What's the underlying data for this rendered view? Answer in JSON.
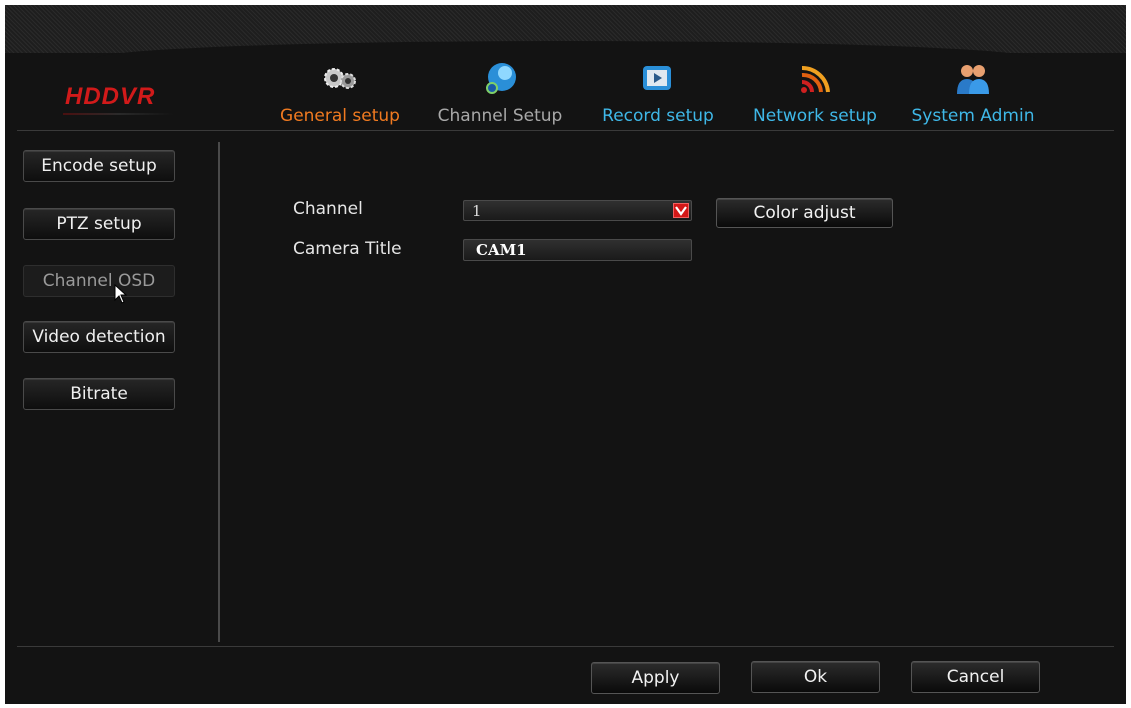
{
  "app": {
    "logo": "HDDVR"
  },
  "tabs": [
    {
      "label": "General setup",
      "icon": "gears-icon",
      "color": "#f07a20"
    },
    {
      "label": "Channel Setup",
      "icon": "camera-icon",
      "color": "#a8a8a8"
    },
    {
      "label": "Record setup",
      "icon": "film-icon",
      "color": "#3fb8e8"
    },
    {
      "label": "Network setup",
      "icon": "wifi-icon",
      "color": "#3fb8e8"
    },
    {
      "label": "System Admin",
      "icon": "users-icon",
      "color": "#3fb8e8"
    }
  ],
  "sidebar": {
    "items": [
      {
        "label": "Encode setup",
        "active": false
      },
      {
        "label": "PTZ setup",
        "active": false
      },
      {
        "label": "Channel OSD",
        "active": true
      },
      {
        "label": "Video detection",
        "active": false
      },
      {
        "label": "Bitrate",
        "active": false
      }
    ]
  },
  "form": {
    "channel_label": "Channel",
    "channel_value": "1",
    "color_adjust_label": "Color adjust",
    "camera_title_label": "Camera Title",
    "camera_title_value": "CAM1"
  },
  "footer": {
    "apply_label": "Apply",
    "ok_label": "Ok",
    "cancel_label": "Cancel"
  },
  "colors": {
    "background": "#131313",
    "logo": "#d11a1a",
    "active_tab": "#f07a20",
    "tab_blue": "#3fb8e8",
    "dropdown_arrow": "#d41818"
  }
}
